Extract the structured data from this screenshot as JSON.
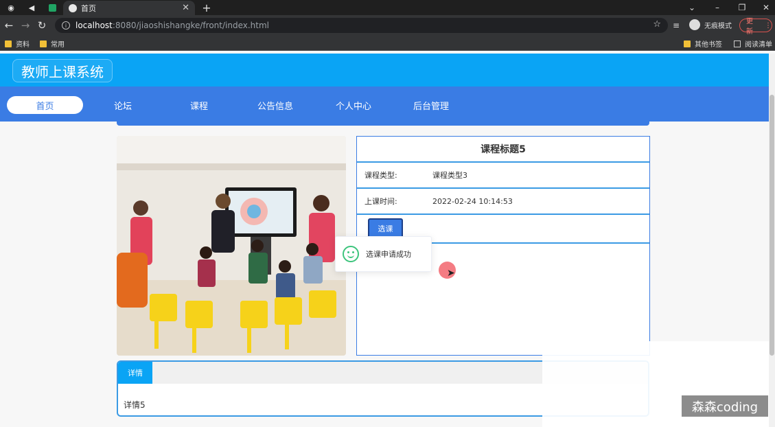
{
  "browser": {
    "tab_title": "首页",
    "url_host": "localhost",
    "url_path": ":8080/jiaoshishangke/front/index.html",
    "incognito_label": "无痕模式",
    "update_label": "更新",
    "bookmarks": [
      "资料",
      "常用"
    ],
    "bookmarks_right": [
      "其他书签",
      "阅读清单"
    ]
  },
  "site": {
    "logo": "教师上课系统",
    "nav": [
      "首页",
      "论坛",
      "课程",
      "公告信息",
      "个人中心",
      "后台管理"
    ]
  },
  "course": {
    "title": "课程标题5",
    "type_label": "课程类型:",
    "type_value": "课程类型3",
    "time_label": "上课时间:",
    "time_value": "2022-02-24 10:14:53",
    "select_button": "选课"
  },
  "toast": {
    "message": "选课申请成功",
    "icon": "smile-icon",
    "color": "#3cc47c"
  },
  "details": {
    "tab": "详情",
    "content": "详情5"
  },
  "watermark": "森森coding",
  "colors": {
    "header": "#0aa4f5",
    "nav": "#3a7ce4",
    "border": "#3a9ae4"
  }
}
